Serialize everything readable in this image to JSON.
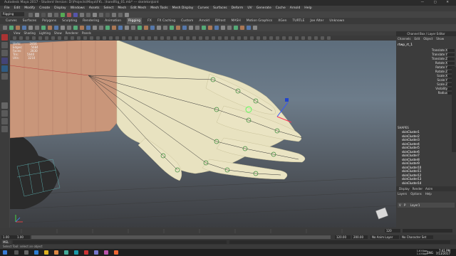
{
  "window": {
    "title": "Autodesk Maya 2017 - Student Version: D:\\Projects\\Maya\\FK\\...\\handRig_01.mb* --- skeletonJoint"
  },
  "menubar": [
    "File",
    "Edit",
    "Modify",
    "Create",
    "Display",
    "Windows",
    "Assets",
    "Select",
    "Mesh",
    "Edit Mesh",
    "Mesh Tools",
    "Mesh Display",
    "Curves",
    "Surfaces",
    "Deform",
    "UV",
    "Generate",
    "Cache",
    "Arnold",
    "Help"
  ],
  "modebar": {
    "mode": "Rigging"
  },
  "shelf_tabs": [
    "Curves",
    "Surfaces",
    "Polygons",
    "Sculpting",
    "Rendering",
    "Animation",
    "Rigging",
    "FX",
    "FX Caching",
    "Custom",
    "Arnold",
    "Bifrost",
    "MASH",
    "Motion Graphics",
    "XGen",
    "TURTLE",
    "Joe Alter",
    "Unknown"
  ],
  "shelf_active": "Rigging",
  "panel_menu": [
    "View",
    "Shading",
    "Lighting",
    "Show",
    "Renderer",
    "Panels"
  ],
  "hud": {
    "labels": [
      "Verts:",
      "Edges:",
      "Faces:",
      "Tris:",
      "UVs:"
    ],
    "values": [
      "2856",
      "5684",
      "2830",
      "5640",
      "3210"
    ]
  },
  "channel_box": {
    "header": "Channel Box / Layer Editor",
    "menu": [
      "Channels",
      "Edit",
      "Object",
      "Show"
    ],
    "object": "rtwp_rt_1",
    "attributes": [
      {
        "name": "Translate X",
        "value": "2.098"
      },
      {
        "name": "Translate Y",
        "value": "0.006"
      },
      {
        "name": "Translate Z",
        "value": "0.061"
      },
      {
        "name": "Rotate X",
        "value": "0"
      },
      {
        "name": "Rotate Y",
        "value": "0"
      },
      {
        "name": "Rotate Z",
        "value": "0"
      },
      {
        "name": "Scale X",
        "value": "1"
      },
      {
        "name": "Scale Y",
        "value": "1"
      },
      {
        "name": "Scale Z",
        "value": "1"
      },
      {
        "name": "Visibility",
        "value": "on"
      },
      {
        "name": "Radius",
        "value": "1"
      }
    ],
    "section": "SHAPES",
    "shapes": [
      "skinCluster1",
      "skinCluster2",
      "skinCluster3",
      "skinCluster4",
      "skinCluster5",
      "skinCluster6",
      "skinCluster7",
      "skinCluster8",
      "skinCluster9",
      "skinCluster10",
      "skinCluster11",
      "skinCluster12",
      "skinCluster13",
      "skinCluster14"
    ]
  },
  "layer_editor": {
    "tabs": [
      "Display",
      "Render",
      "Anim"
    ],
    "menu": [
      "Layers",
      "Options",
      "Help"
    ],
    "layers": [
      {
        "v": "V",
        "p": "P",
        "name": "Layer1"
      }
    ]
  },
  "timeline": {
    "start": "1.00",
    "end": "120.00",
    "range_start": "1.00",
    "range_end": "200.00",
    "current": "120",
    "anim_layer": "No Anim Layer",
    "char_set": "No Character Set"
  },
  "help_line": "Select Tool: select an object",
  "command_lang": "MEL",
  "taskbar": {
    "stats": [
      "1.6 Kbps",
      "1.4 Kbps"
    ],
    "lang": "ENG",
    "time": "7:41 PM",
    "date": "7/13/2017"
  },
  "colors": {
    "viewport_top": "#5b6b7a",
    "viewport_bottom": "#3b3d41",
    "skin": "#e8e2c0",
    "sleeve": "#c9967a",
    "joint_highlight": "#55ff55",
    "selected": "#2f5b82"
  }
}
